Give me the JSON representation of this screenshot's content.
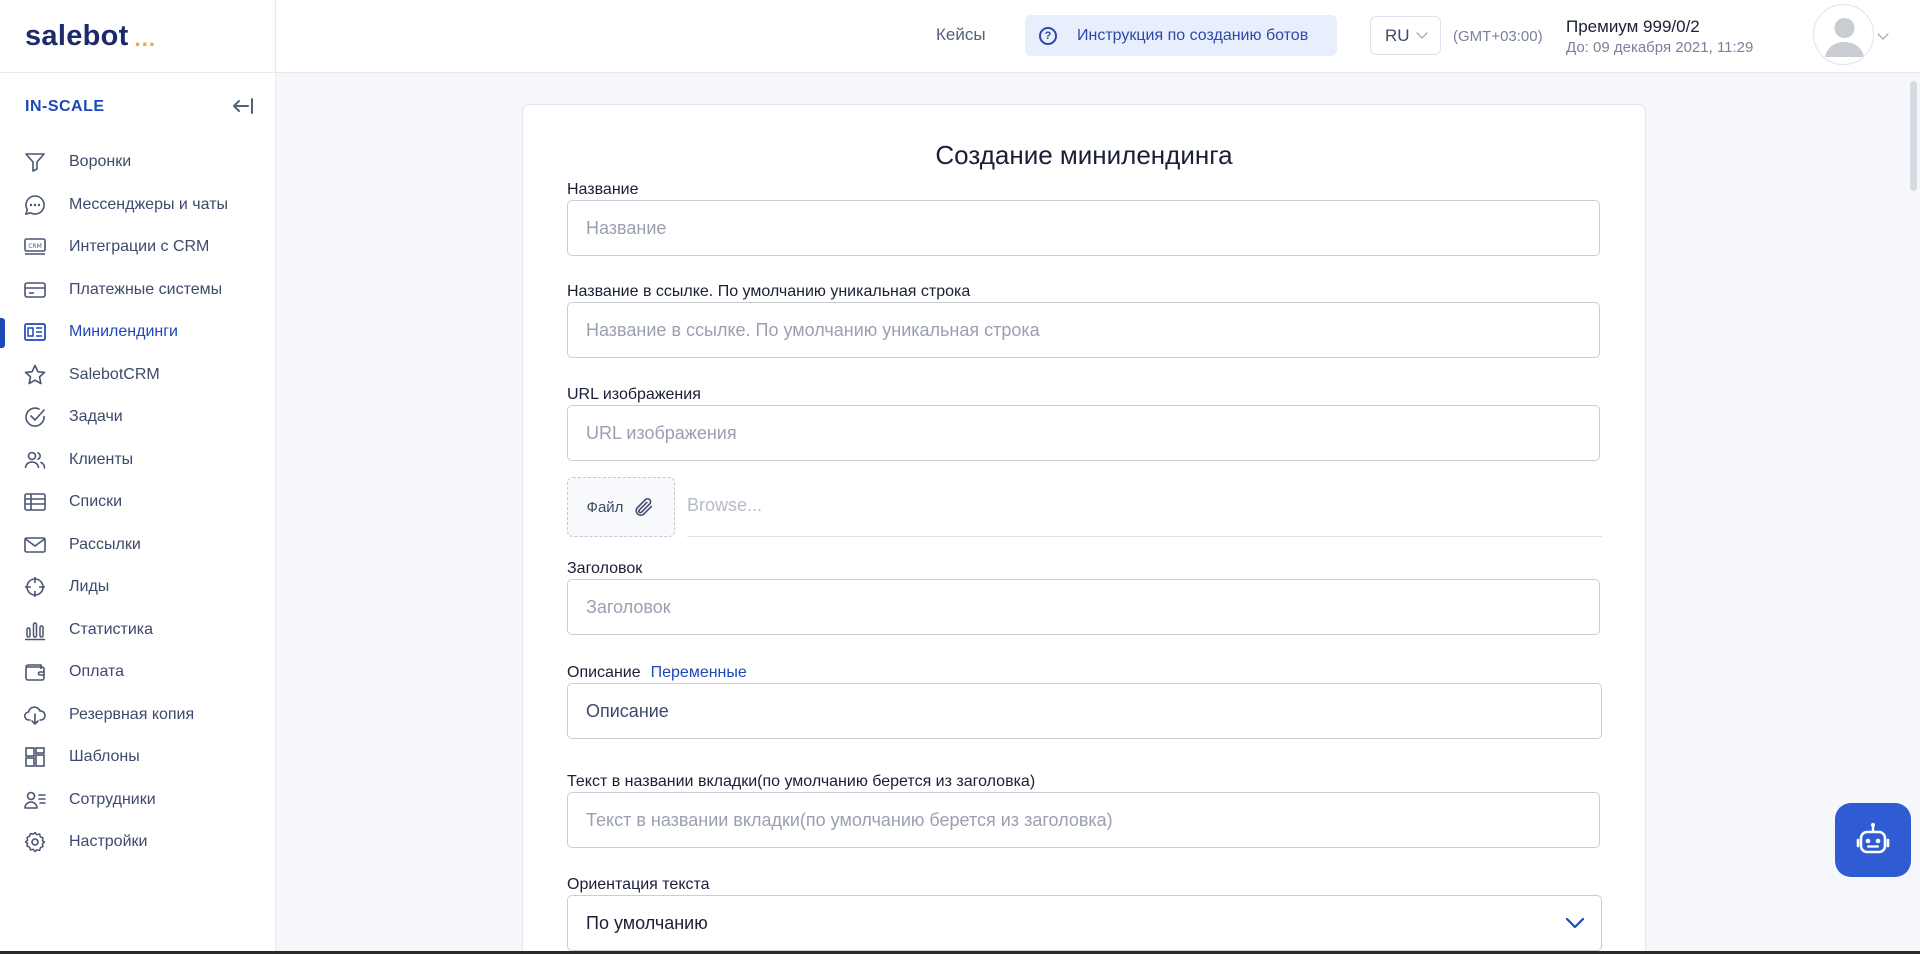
{
  "app": {
    "logo_text": "salebot",
    "logo_dots": "..."
  },
  "sidebar": {
    "project": "IN-SCALE",
    "items": [
      {
        "label": "Воронки",
        "icon": "funnel-icon"
      },
      {
        "label": "Мессенджеры и чаты",
        "icon": "chat-icon"
      },
      {
        "label": "Интеграции с CRM",
        "icon": "crm-icon"
      },
      {
        "label": "Платежные системы",
        "icon": "card-icon"
      },
      {
        "label": "Минилендинги",
        "icon": "landing-icon",
        "active": true
      },
      {
        "label": "SalebotCRM",
        "icon": "star-icon"
      },
      {
        "label": "Задачи",
        "icon": "check-circle-icon"
      },
      {
        "label": "Клиенты",
        "icon": "users-icon"
      },
      {
        "label": "Списки",
        "icon": "table-icon"
      },
      {
        "label": "Рассылки",
        "icon": "mail-icon"
      },
      {
        "label": "Лиды",
        "icon": "target-icon"
      },
      {
        "label": "Статистика",
        "icon": "bar-chart-icon"
      },
      {
        "label": "Оплата",
        "icon": "wallet-icon"
      },
      {
        "label": "Резервная копия",
        "icon": "cloud-download-icon"
      },
      {
        "label": "Шаблоны",
        "icon": "templates-icon"
      },
      {
        "label": "Сотрудники",
        "icon": "staff-icon"
      },
      {
        "label": "Настройки",
        "icon": "gear-icon"
      }
    ]
  },
  "header": {
    "cases": "Кейсы",
    "guide": "Инструкция по созданию ботов",
    "lang": "RU",
    "timezone": "(GMT+03:00)",
    "plan": "Премиум 999/0/2",
    "plan_until": "До: 09 декабря 2021, 11:29"
  },
  "form": {
    "title": "Создание минилендинга",
    "name_label": "Название",
    "name_placeholder": "Название",
    "slug_label": "Название в ссылке. По умолчанию уникальная строка",
    "slug_placeholder": "Название в ссылке. По умолчанию уникальная строка",
    "image_label": "URL изображения",
    "image_placeholder": "URL изображения",
    "file_button": "Файл",
    "browse_placeholder": "Browse...",
    "heading_label": "Заголовок",
    "heading_placeholder": "Заголовок",
    "description_label": "Описание",
    "variables_link": "Переменные",
    "description_value": "Описание",
    "tab_label": "Текст в названии вкладки(по умолчанию берется из заголовка)",
    "tab_placeholder": "Текст в названии вкладки(по умолчанию берется из заголовка)",
    "orientation_label": "Ориентация текста",
    "orientation_value": "По умолчанию"
  },
  "colors": {
    "accent": "#1c48b8",
    "logo_dots": "#f0a63a",
    "bot_button": "#2f5bd3"
  }
}
